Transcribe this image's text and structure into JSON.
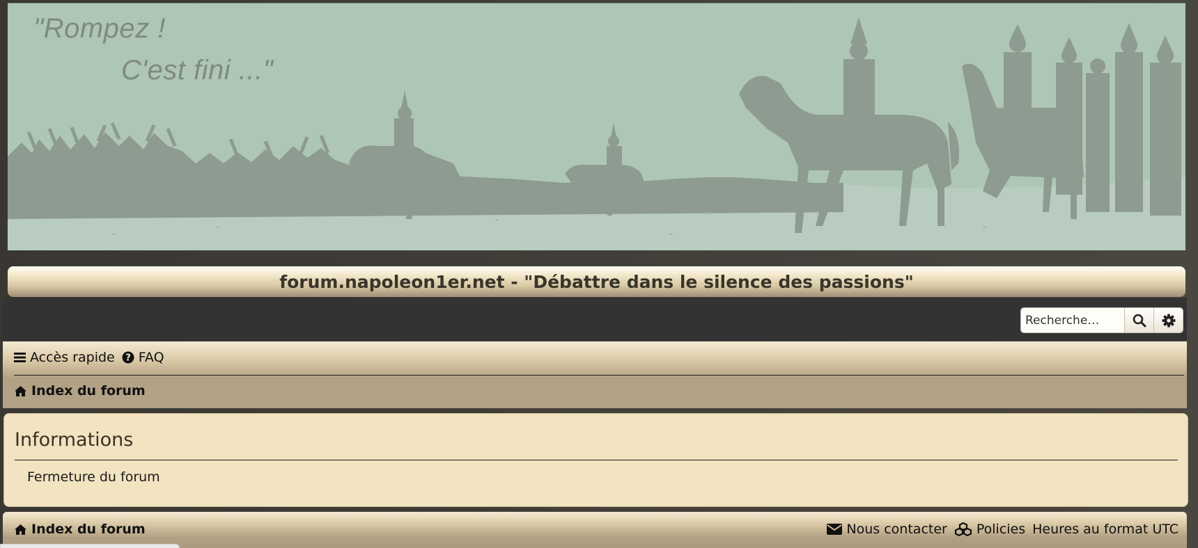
{
  "banner": {
    "quote_line1": "\"Rompez !",
    "quote_line2": "C'est fini ...\""
  },
  "header": {
    "site_title": "forum.napoleon1er.net - \"Débattre dans le silence des passions\""
  },
  "search": {
    "placeholder": "Recherche…",
    "search_icon": "search-icon",
    "advanced_icon": "gear-icon"
  },
  "navbar": {
    "quick_access_label": "Accès rapide",
    "quick_access_icon": "bars-icon",
    "faq_label": "FAQ",
    "faq_icon": "question-circle-icon",
    "breadcrumb_label": "Index du forum",
    "breadcrumb_icon": "home-icon"
  },
  "panel": {
    "heading": "Informations",
    "message": "Fermeture du forum"
  },
  "footer": {
    "breadcrumb_label": "Index du forum",
    "contact_label": "Nous contacter",
    "contact_icon": "envelope-icon",
    "policies_label": "Policies",
    "policies_icon": "cubes-icon",
    "timezone_label": "Heures au format UTC"
  },
  "colors": {
    "banner_bg": "#aec6b5",
    "silhouette": "#8d9b90",
    "panel_bg": "#f2e3c1",
    "dark_strip": "#333333"
  }
}
